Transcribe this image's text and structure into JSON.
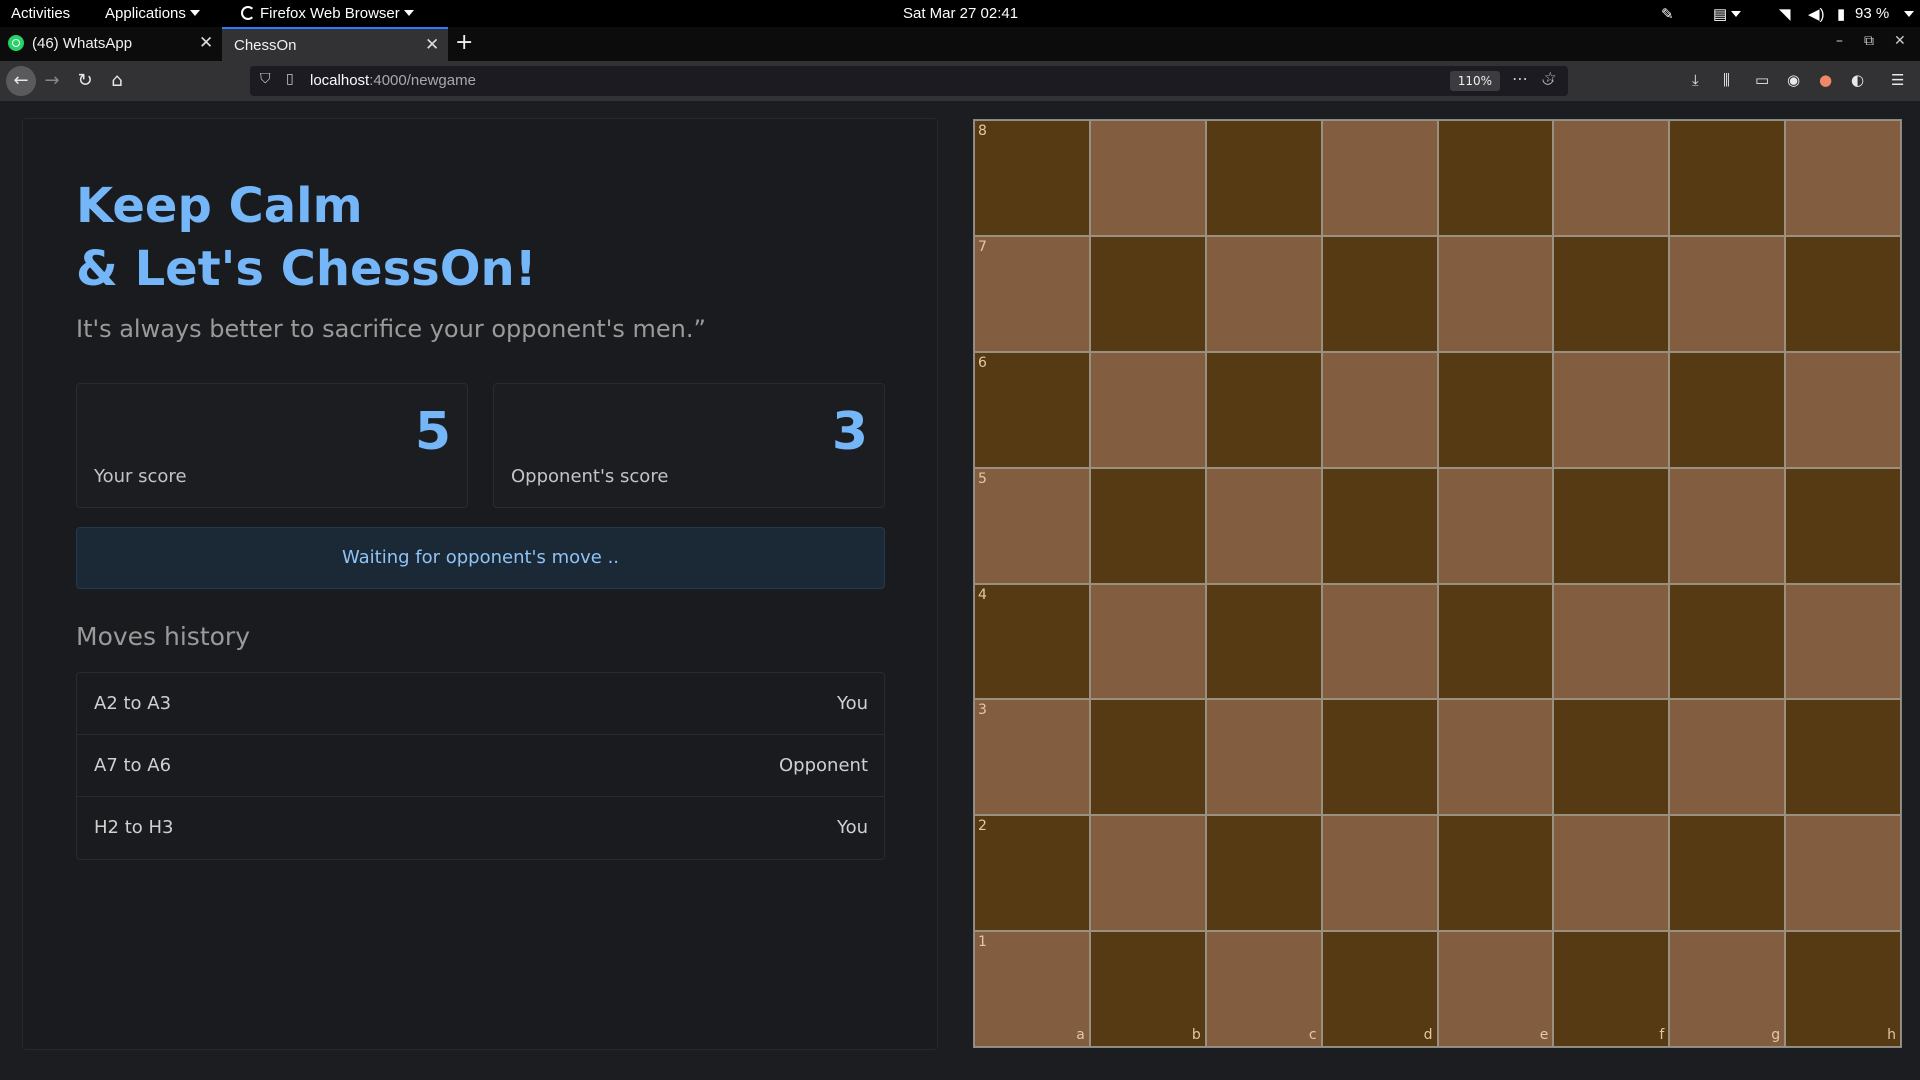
{
  "system": {
    "activities": "Activities",
    "applications": "Applications",
    "browser_menu": "Firefox Web Browser",
    "datetime": "Sat Mar 27  02:41",
    "battery": "93 %"
  },
  "tabs": [
    {
      "title": "(46) WhatsApp"
    },
    {
      "title": "ChessOn"
    }
  ],
  "nav": {
    "url_host": "localhost",
    "url_path": ":4000/newgame",
    "zoom": "110%"
  },
  "hero": {
    "line1": "Keep Calm",
    "line2": "& Let's ChessOn!",
    "quote": "It's always better to sacrifice your opponent's men.”"
  },
  "scores": {
    "you_value": "5",
    "you_label": "Your score",
    "opponent_value": "3",
    "opponent_label": "Opponent's score"
  },
  "status": "Waiting for opponent's move ..",
  "history": {
    "title": "Moves history",
    "moves": [
      {
        "move": "A2 to A3",
        "player": "You"
      },
      {
        "move": "A7 to A6",
        "player": "Opponent"
      },
      {
        "move": "H2 to H3",
        "player": "You"
      }
    ]
  },
  "board": {
    "ranks": [
      "8",
      "7",
      "6",
      "5",
      "4",
      "3",
      "2",
      "1"
    ],
    "files": [
      "a",
      "b",
      "c",
      "d",
      "e",
      "f",
      "g",
      "h"
    ],
    "colors": {
      "dark": "#553a13",
      "light": "#835d40"
    }
  }
}
